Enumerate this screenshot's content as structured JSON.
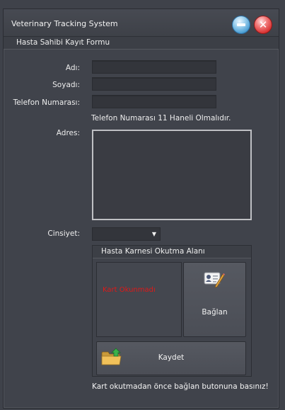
{
  "window": {
    "title": "Veterinary Tracking System",
    "minimize_icon": "minus-circle-icon",
    "close_icon": "close-circle-icon"
  },
  "form": {
    "section_title": "Hasta Sahibi Kayıt Formu",
    "first_name_label": "Adı:",
    "first_name_value": "",
    "last_name_label": "Soyadı:",
    "last_name_value": "",
    "phone_label": "Telefon Numarası:",
    "phone_value": "",
    "phone_hint": "Telefon Numarası 11 Haneli Olmalıdır.",
    "address_label": "Adres:",
    "address_value": "",
    "gender_label": "Cinsiyet:",
    "gender_value": ""
  },
  "card_reader": {
    "group_title": "Hasta Karnesi Okutma Alanı",
    "status_text": "Kart Okunmadı",
    "status_color": "#e01818",
    "connect_label": "Bağlan",
    "connect_icon": "id-card-pen-icon",
    "save_label": "Kaydet",
    "save_icon": "folder-upload-icon"
  },
  "footer_note": "Kart okutmadan önce bağlan butonuna basınız!"
}
